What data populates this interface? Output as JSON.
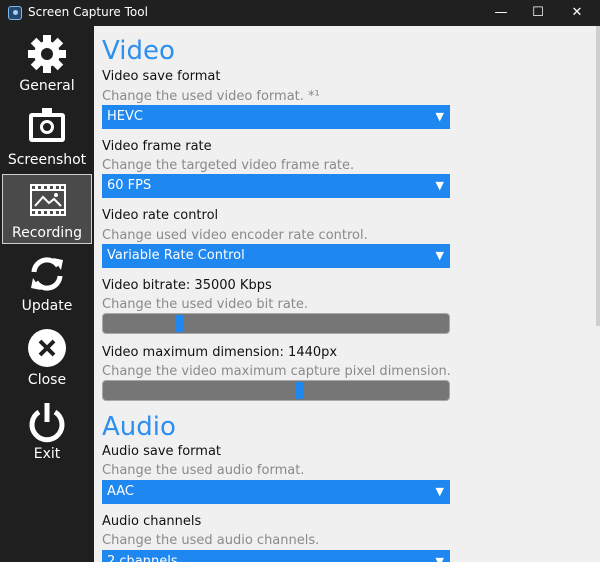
{
  "window": {
    "title": "Screen Capture Tool",
    "controls": {
      "minimize": "—",
      "maximize": "☐",
      "close": "✕"
    }
  },
  "sidebar": {
    "items": [
      {
        "label": "General",
        "icon": "gear-icon"
      },
      {
        "label": "Screenshot",
        "icon": "monitor-icon"
      },
      {
        "label": "Recording",
        "icon": "film-icon",
        "active": true
      },
      {
        "label": "Update",
        "icon": "refresh-icon"
      },
      {
        "label": "Close",
        "icon": "x-circle-icon"
      },
      {
        "label": "Exit",
        "icon": "power-icon"
      }
    ]
  },
  "main": {
    "video": {
      "heading": "Video",
      "save_format": {
        "label": "Video save format",
        "description": "Change the used video format. *¹",
        "value": "HEVC"
      },
      "frame_rate": {
        "label": "Video frame rate",
        "description": "Change the targeted video frame rate.",
        "value": "60 FPS"
      },
      "rate_control": {
        "label": "Video rate control",
        "description": "Change used video encoder rate control.",
        "value": "Variable Rate Control"
      },
      "bitrate": {
        "label": "Video bitrate: 35000 Kbps",
        "description": "Change the used video bit rate.",
        "level": 0.22
      },
      "max_dimension": {
        "label": "Video maximum dimension: 1440px",
        "description": "Change the video maximum capture pixel dimension.",
        "level": 0.57
      }
    },
    "audio": {
      "heading": "Audio",
      "save_format": {
        "label": "Audio save format",
        "description": "Change the used audio format.",
        "value": "AAC"
      },
      "channels": {
        "label": "Audio channels",
        "description": "Change the used audio channels.",
        "value": "2 channels"
      }
    }
  },
  "colors": {
    "accent": "#1e88f0",
    "heading": "#2d8ff0",
    "sidebar": "#1f1f1f",
    "content": "#f0f0f0"
  }
}
